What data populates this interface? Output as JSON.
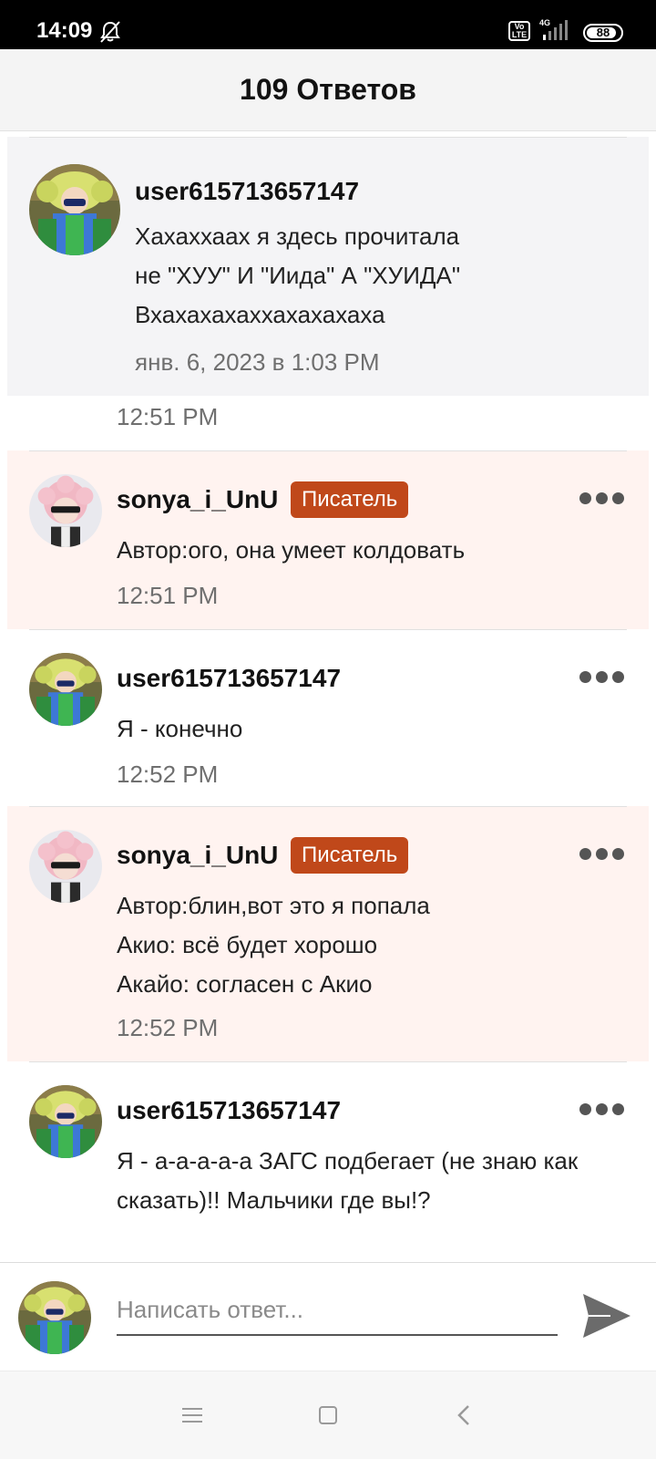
{
  "status_bar": {
    "time": "14:09",
    "volte": "Vo LTE",
    "network": "4G",
    "battery": "88",
    "battery_level": 0.88,
    "icons": [
      "bell-muted-icon",
      "volte-icon",
      "signal-icon",
      "battery-icon"
    ]
  },
  "header": {
    "title": "109 Ответов"
  },
  "parent_comment": {
    "user": "user615713657147",
    "text_lines": [
      "Хахаххаах я здесь прочитала",
      "не \"ХУУ\" И \"Иида\" А \"ХУИДА\"",
      "Вхахахахаххахахахаха"
    ],
    "date": "янв. 6, 2023 в 1:03 PM"
  },
  "orphan_time": "12:51 PM",
  "comments": [
    {
      "user": "sonya_i_UnU",
      "badge": "Писатель",
      "text_lines": [
        "Автор:ого, она умеет колдовать"
      ],
      "time": "12:51 PM"
    },
    {
      "user": "user615713657147",
      "badge": "",
      "text_lines": [
        "Я - конечно"
      ],
      "time": "12:52 PM"
    },
    {
      "user": "sonya_i_UnU",
      "badge": "Писатель",
      "text_lines": [
        "Автор:блин,вот это я попала",
        "Акио: всё будет хорошо",
        "Акайо: согласен с Акио"
      ],
      "time": "12:52 PM"
    },
    {
      "user": "user615713657147",
      "badge": "",
      "text_lines": [
        "Я - а-а-а-а-а ЗАГС подбегает (не знаю как",
        "сказать)!! Мальчики где вы!?"
      ],
      "time": ""
    }
  ],
  "composer": {
    "placeholder": "Написать ответ...",
    "value": ""
  },
  "colors": {
    "badge": "#c0481a",
    "highlight": "#fff3f0",
    "parent_bg": "#f4f4f6",
    "muted_text": "#6f6f6f"
  },
  "nav_bar": {
    "icons": [
      "menu-icon",
      "home-square-icon",
      "back-chevron-icon"
    ]
  }
}
